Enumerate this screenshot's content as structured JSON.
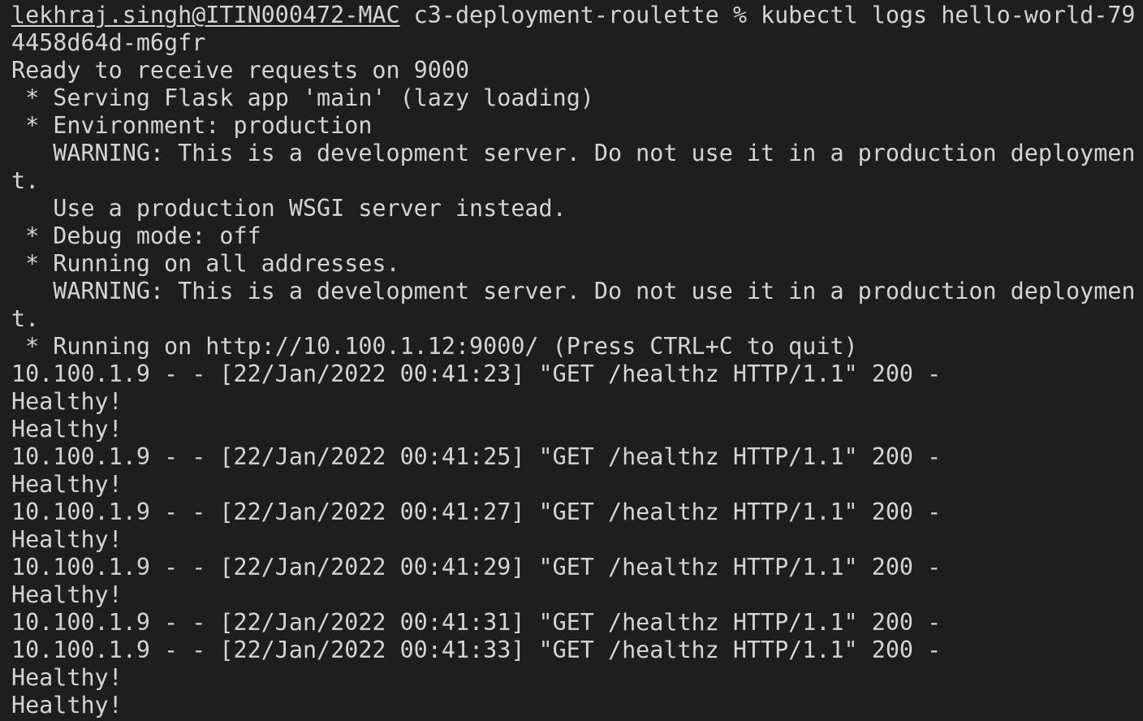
{
  "terminal": {
    "prompt_user": "lekhraj.singh@ITIN000472-MAC",
    "prompt_rest": " c3-deployment-roulette % kubectl logs hello-world-79",
    "lines": [
      "4458d64d-m6gfr",
      "Ready to receive requests on 9000",
      " * Serving Flask app 'main' (lazy loading)",
      " * Environment: production",
      "   WARNING: This is a development server. Do not use it in a production deploymen",
      "t.",
      "   Use a production WSGI server instead.",
      " * Debug mode: off",
      " * Running on all addresses.",
      "   WARNING: This is a development server. Do not use it in a production deploymen",
      "t.",
      " * Running on http://10.100.1.12:9000/ (Press CTRL+C to quit)",
      "10.100.1.9 - - [22/Jan/2022 00:41:23] \"GET /healthz HTTP/1.1\" 200 -",
      "Healthy!",
      "Healthy!",
      "10.100.1.9 - - [22/Jan/2022 00:41:25] \"GET /healthz HTTP/1.1\" 200 -",
      "Healthy!",
      "10.100.1.9 - - [22/Jan/2022 00:41:27] \"GET /healthz HTTP/1.1\" 200 -",
      "Healthy!",
      "10.100.1.9 - - [22/Jan/2022 00:41:29] \"GET /healthz HTTP/1.1\" 200 -",
      "Healthy!",
      "10.100.1.9 - - [22/Jan/2022 00:41:31] \"GET /healthz HTTP/1.1\" 200 -",
      "10.100.1.9 - - [22/Jan/2022 00:41:33] \"GET /healthz HTTP/1.1\" 200 -",
      "Healthy!",
      "Healthy!"
    ]
  },
  "colors": {
    "background": "#1e1e1e",
    "text": "#d4d4d4"
  }
}
